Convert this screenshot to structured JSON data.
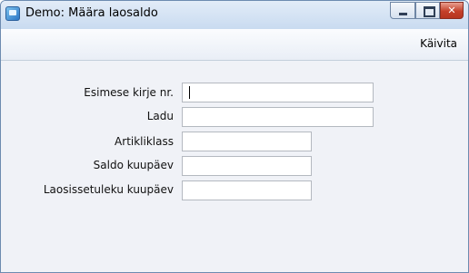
{
  "window": {
    "title": "Demo: Määra laosaldo",
    "buttons": {
      "close_glyph": "✕"
    }
  },
  "toolbar": {
    "run_label": "Käivita"
  },
  "form": {
    "fields": [
      {
        "label": "Esimese kirje nr.",
        "value": ""
      },
      {
        "label": "Ladu",
        "value": ""
      },
      {
        "label": "Artikliklass",
        "value": ""
      },
      {
        "label": "Saldo kuupäev",
        "value": ""
      },
      {
        "label": "Laosissetuleku kuupäev",
        "value": ""
      }
    ]
  }
}
